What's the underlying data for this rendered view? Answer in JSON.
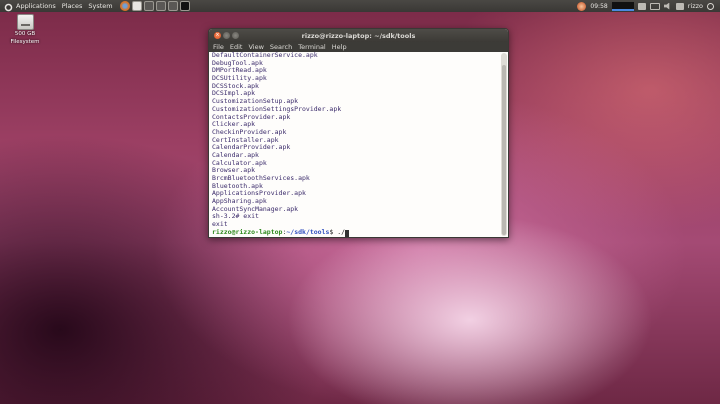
{
  "panel": {
    "menus": [
      "Applications",
      "Places",
      "System"
    ],
    "launchers": [
      "firefox-icon",
      "chromium-icon",
      "text-editor-icon",
      "text-editor-icon",
      "text-editor-icon",
      "terminal-icon"
    ],
    "clock": "09:58",
    "user": "rizzo"
  },
  "desktop": {
    "icon_label_line1": "500 GB",
    "icon_label_line2": "Filesystem"
  },
  "terminal": {
    "title": "rizzo@rizzo-laptop: ~/sdk/tools",
    "menu": [
      "File",
      "Edit",
      "View",
      "Search",
      "Terminal",
      "Help"
    ],
    "lines": [
      "DefaultContainerService.apk",
      "DebugTool.apk",
      "DMPortRead.apk",
      "DCSUtility.apk",
      "DCSStock.apk",
      "DCSImpl.apk",
      "CustomizationSetup.apk",
      "CustomizationSettingsProvider.apk",
      "ContactsProvider.apk",
      "Clicker.apk",
      "CheckinProvider.apk",
      "CertInstaller.apk",
      "CalendarProvider.apk",
      "Calendar.apk",
      "Calculator.apk",
      "Browser.apk",
      "BrcmBluetoothServices.apk",
      "Bluetooth.apk",
      "ApplicationsProvider.apk",
      "AppSharing.apk",
      "AccountSyncManager.apk",
      "sh-3.2# exit",
      "exit"
    ],
    "prompt_user": "rizzo@rizzo-laptop",
    "prompt_sep": ":",
    "prompt_path": "~/sdk/tools",
    "prompt_tail": "$ ./"
  }
}
